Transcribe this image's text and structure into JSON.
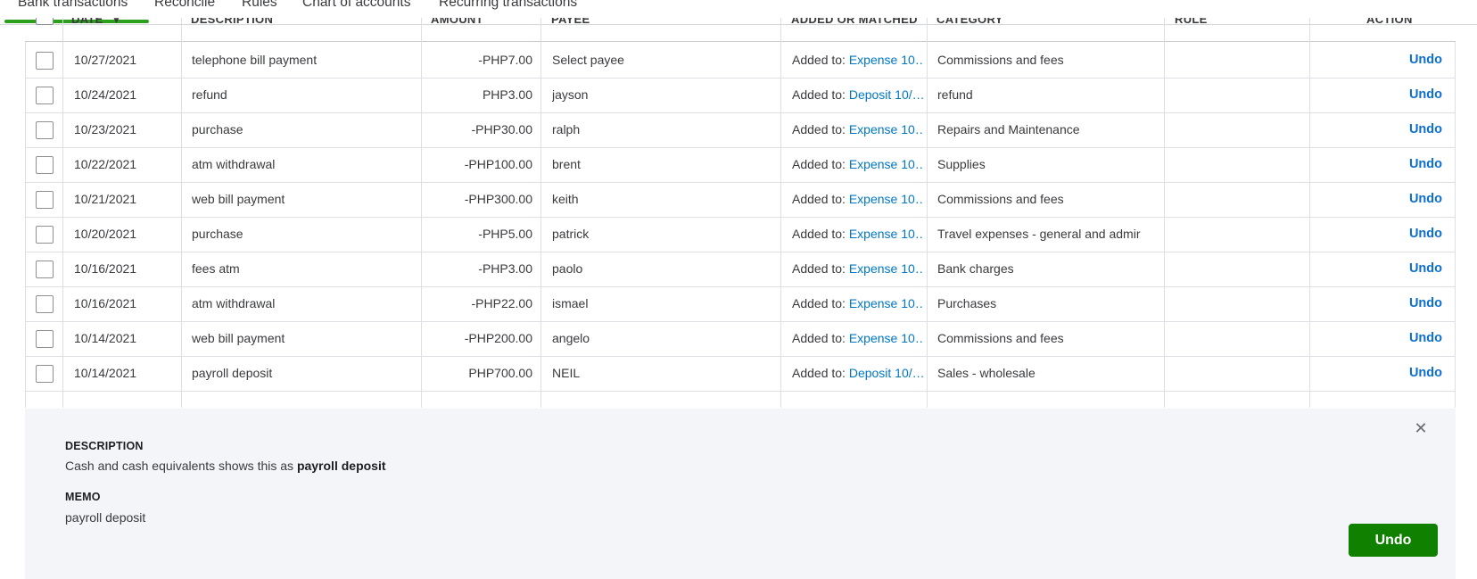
{
  "tabs": [
    {
      "label": "Bank transactions",
      "active": true
    },
    {
      "label": "Reconcile"
    },
    {
      "label": "Rules"
    },
    {
      "label": "Chart of accounts"
    },
    {
      "label": "Recurring transactions"
    }
  ],
  "table": {
    "headers": {
      "date": "DATE",
      "date_sort": "▼",
      "description": "DESCRIPTION",
      "amount": "AMOUNT",
      "payee": "PAYEE",
      "added_or_matched": "ADDED OR MATCHED",
      "category": "CATEGORY",
      "rule": "RULE",
      "action": "ACTION"
    },
    "rows": [
      {
        "date": "10/27/2021",
        "description": "telephone bill payment",
        "amount": "-PHP7.00",
        "payee": "Select payee",
        "added_prefix": "Added to:",
        "added_link": "Expense 10…",
        "category": "Commissions and fees",
        "rule": "",
        "action": "Undo"
      },
      {
        "date": "10/24/2021",
        "description": "refund",
        "amount": "PHP3.00",
        "payee": "jayson",
        "added_prefix": "Added to:",
        "added_link": "Deposit 10/…",
        "category": "refund",
        "rule": "",
        "action": "Undo"
      },
      {
        "date": "10/23/2021",
        "description": "purchase",
        "amount": "-PHP30.00",
        "payee": "ralph",
        "added_prefix": "Added to:",
        "added_link": "Expense 10…",
        "category": "Repairs and Maintenance",
        "rule": "",
        "action": "Undo"
      },
      {
        "date": "10/22/2021",
        "description": "atm withdrawal",
        "amount": "-PHP100.00",
        "payee": "brent",
        "added_prefix": "Added to:",
        "added_link": "Expense 10…",
        "category": "Supplies",
        "rule": "",
        "action": "Undo"
      },
      {
        "date": "10/21/2021",
        "description": "web bill payment",
        "amount": "-PHP300.00",
        "payee": "keith",
        "added_prefix": "Added to:",
        "added_link": "Expense 10…",
        "category": "Commissions and fees",
        "rule": "",
        "action": "Undo"
      },
      {
        "date": "10/20/2021",
        "description": "purchase",
        "amount": "-PHP5.00",
        "payee": "patrick",
        "added_prefix": "Added to:",
        "added_link": "Expense 10…",
        "category": "Travel expenses - general and admir",
        "rule": "",
        "action": "Undo"
      },
      {
        "date": "10/16/2021",
        "description": "fees atm",
        "amount": "-PHP3.00",
        "payee": "paolo",
        "added_prefix": "Added to:",
        "added_link": "Expense 10…",
        "category": "Bank charges",
        "rule": "",
        "action": "Undo"
      },
      {
        "date": "10/16/2021",
        "description": "atm withdrawal",
        "amount": "-PHP22.00",
        "payee": "ismael",
        "added_prefix": "Added to:",
        "added_link": "Expense 10…",
        "category": "Purchases",
        "rule": "",
        "action": "Undo"
      },
      {
        "date": "10/14/2021",
        "description": "web bill payment",
        "amount": "-PHP200.00",
        "payee": "angelo",
        "added_prefix": "Added to:",
        "added_link": "Expense 10…",
        "category": "Commissions and fees",
        "rule": "",
        "action": "Undo"
      },
      {
        "date": "10/14/2021",
        "description": "payroll deposit",
        "amount": "PHP700.00",
        "payee": "NEIL",
        "added_prefix": "Added to:",
        "added_link": "Deposit 10/…",
        "category": "Sales - wholesale",
        "rule": "",
        "action": "Undo"
      }
    ]
  },
  "detail": {
    "description_label": "DESCRIPTION",
    "description_prefix": "Cash and cash equivalents shows this as ",
    "description_value": "payroll deposit",
    "memo_label": "MEMO",
    "memo_value": "payroll deposit",
    "close_icon": "close-icon",
    "undo_button": "Undo"
  },
  "colors": {
    "brand_green": "#2ca01c",
    "button_green": "#108000",
    "link_blue": "#0077c5",
    "panel_bg": "#f4f5f8"
  }
}
